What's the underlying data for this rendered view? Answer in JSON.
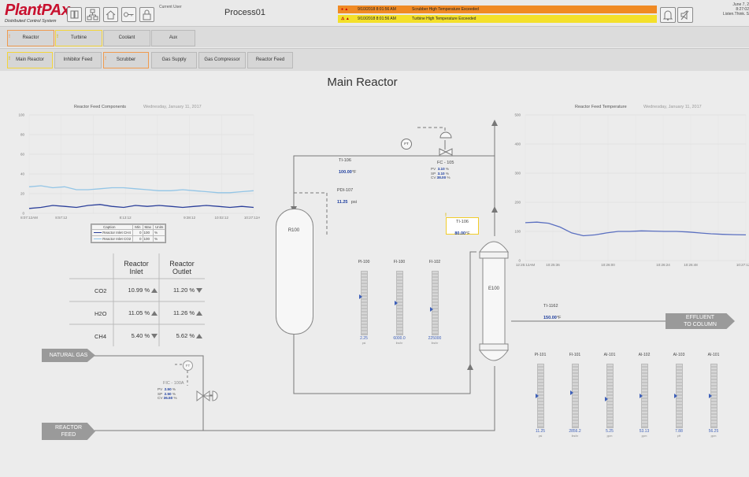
{
  "header": {
    "logo": "PlantPAx",
    "logo_sub": "Distributed Control System",
    "current_user_label": "Current User",
    "display_name": "Process01",
    "alarms": [
      {
        "time": "9/10/2018 8:01:56 AM",
        "message": "Scrubber High Temperature Exceeded",
        "color": "#f08a24"
      },
      {
        "time": "9/10/2018 8:01:56 AM",
        "message": "Turbine High Temperature Exceeded",
        "color": "#f4e02a"
      }
    ],
    "date": "June 7, 2",
    "time": "8:27:02",
    "motto": "Listen.Think. S"
  },
  "tabs_area": [
    {
      "label": "Reactor",
      "alarm": "!",
      "status": "orange"
    },
    {
      "label": "Turbine",
      "alarm": "!",
      "status": "yellow"
    },
    {
      "label": "Coolant",
      "alarm": "",
      "status": "none"
    },
    {
      "label": "Aux",
      "alarm": "",
      "status": "none"
    }
  ],
  "tabs_display": [
    {
      "label": "Main Reactor",
      "alarm": "!",
      "status": "yellow"
    },
    {
      "label": "Inhibitor Feed",
      "alarm": "",
      "status": "none"
    },
    {
      "label": "Scrubber",
      "alarm": "!",
      "status": "orange"
    },
    {
      "label": "Gas Supply",
      "alarm": "",
      "status": "none"
    },
    {
      "label": "Gas Compressor",
      "alarm": "",
      "status": "none"
    },
    {
      "label": "Reactor Feed",
      "alarm": "",
      "status": "none"
    }
  ],
  "page_title": "Main Reactor",
  "left_trend": {
    "title": "Reactor Feed Components",
    "date": "Wednesday, January 11, 2017",
    "y_ticks": [
      "100",
      "80",
      "60",
      "40",
      "20",
      "0"
    ],
    "x_ticks": [
      "8:07:12AM",
      "8:57:12",
      "",
      "8:13:12",
      "",
      "9:38:12",
      "10:02:12",
      "10:27:12AM"
    ],
    "legend_headers": [
      "Caption",
      "Min",
      "Max",
      "Units"
    ],
    "legend_rows": [
      {
        "caption": "Reactor Inlet CH4",
        "min": "0",
        "max": "100",
        "units": "%"
      },
      {
        "caption": "Reactor Inlet CO2",
        "min": "0",
        "max": "100",
        "units": "%"
      }
    ]
  },
  "right_trend": {
    "title": "Reactor Feed Temperature",
    "date": "Wednesday, January 11, 2017",
    "y_ticks": [
      "500",
      "400",
      "300",
      "200",
      "100",
      "0"
    ],
    "x_ticks": [
      "12:25:12AM",
      "10:25:36",
      "",
      "10:26:00",
      "",
      "10:26:24",
      "10:26:48",
      "",
      "10:27:12AM"
    ]
  },
  "chart_data": [
    {
      "type": "line",
      "title": "Reactor Feed Components",
      "ylim": [
        0,
        100
      ],
      "series": [
        {
          "name": "Reactor Inlet CH4",
          "color": "#2b3f9a",
          "values": [
            5,
            6,
            8,
            7,
            6,
            8,
            9,
            7,
            6,
            8,
            7,
            8,
            7,
            6,
            7,
            8,
            7,
            6,
            7,
            6
          ]
        },
        {
          "name": "Reactor Inlet CO2",
          "color": "#93c5e6",
          "values": [
            27,
            28,
            26,
            27,
            24,
            24,
            25,
            26,
            26,
            25,
            24,
            23,
            23,
            24,
            23,
            22,
            21,
            21,
            22,
            23
          ]
        }
      ]
    },
    {
      "type": "line",
      "title": "Reactor Feed Temperature",
      "ylim": [
        0,
        500
      ],
      "series": [
        {
          "name": "",
          "color": "#5a6fc0",
          "values": [
            130,
            132,
            128,
            115,
            95,
            85,
            88,
            95,
            100,
            100,
            102,
            101,
            100,
            100,
            98,
            95,
            92,
            90,
            89,
            88
          ]
        }
      ]
    }
  ],
  "comp_table": {
    "col1": "Reactor\nInlet",
    "col2": "Reactor\nOutlet",
    "rows": [
      {
        "name": "CO2",
        "inlet": "10.99 %",
        "inlet_dir": "up",
        "outlet": "11.20 %",
        "outlet_dir": "down"
      },
      {
        "name": "H2O",
        "inlet": "11.05 %",
        "inlet_dir": "up",
        "outlet": "11.26 %",
        "outlet_dir": "up"
      },
      {
        "name": "CH4",
        "inlet": "5.40 %",
        "inlet_dir": "down",
        "outlet": "5.62 %",
        "outlet_dir": "up"
      }
    ]
  },
  "process": {
    "natural_gas": "NATURAL GAS",
    "reactor_feed_l1": "REACTOR",
    "reactor_feed_l2": "FEED",
    "effluent_l1": "EFFLUENT",
    "effluent_l2": "TO COLUMN",
    "r100": "R100",
    "e100": "E100",
    "ti106": {
      "name": "TI-106",
      "value": "100.00",
      "unit": "°F"
    },
    "pdi107": {
      "name": "PDI-107",
      "value": "11.25",
      "unit": "psi"
    },
    "ti106b": {
      "name": "TI-106",
      "value": "80.00",
      "unit": "°F",
      "alarm": "!"
    },
    "ti1162": {
      "name": "TI-1162",
      "value": "150.00",
      "unit": "°F"
    },
    "fc105": {
      "name": "FC - 105",
      "pv": "3.10",
      "sp": "3.10",
      "cv": "38.00",
      "unit": "%"
    },
    "fic100a": {
      "name": "FIC - 100A",
      "pv": "2.50",
      "sp": "2.50",
      "cv": "36.50",
      "unit": "%"
    },
    "ft_symbol": "FT"
  },
  "center_bars": [
    {
      "label": "PI-100",
      "value": "2.25",
      "unit": "psi",
      "level": 0.6
    },
    {
      "label": "FI-100",
      "value": "6000.0",
      "unit": "lbs/hr",
      "level": 0.5
    },
    {
      "label": "FI-102",
      "value": "225000",
      "unit": "lbs/hr",
      "level": 0.4
    }
  ],
  "right_bars": [
    {
      "label": "PI-101",
      "value": "11.25",
      "unit": "psi",
      "level": 0.5
    },
    {
      "label": "FI-101",
      "value": "2856.2",
      "unit": "lbs/hr",
      "level": 0.55
    },
    {
      "label": "AI-101",
      "value": "5.25",
      "unit": "ppm",
      "level": 0.45
    },
    {
      "label": "AI-102",
      "value": "53.13",
      "unit": "ppm",
      "level": 0.5
    },
    {
      "label": "AI-103",
      "value": "7.88",
      "unit": "pH",
      "level": 0.5
    },
    {
      "label": "AI-101",
      "value": "56.25",
      "unit": "ppm",
      "level": 0.5
    }
  ]
}
